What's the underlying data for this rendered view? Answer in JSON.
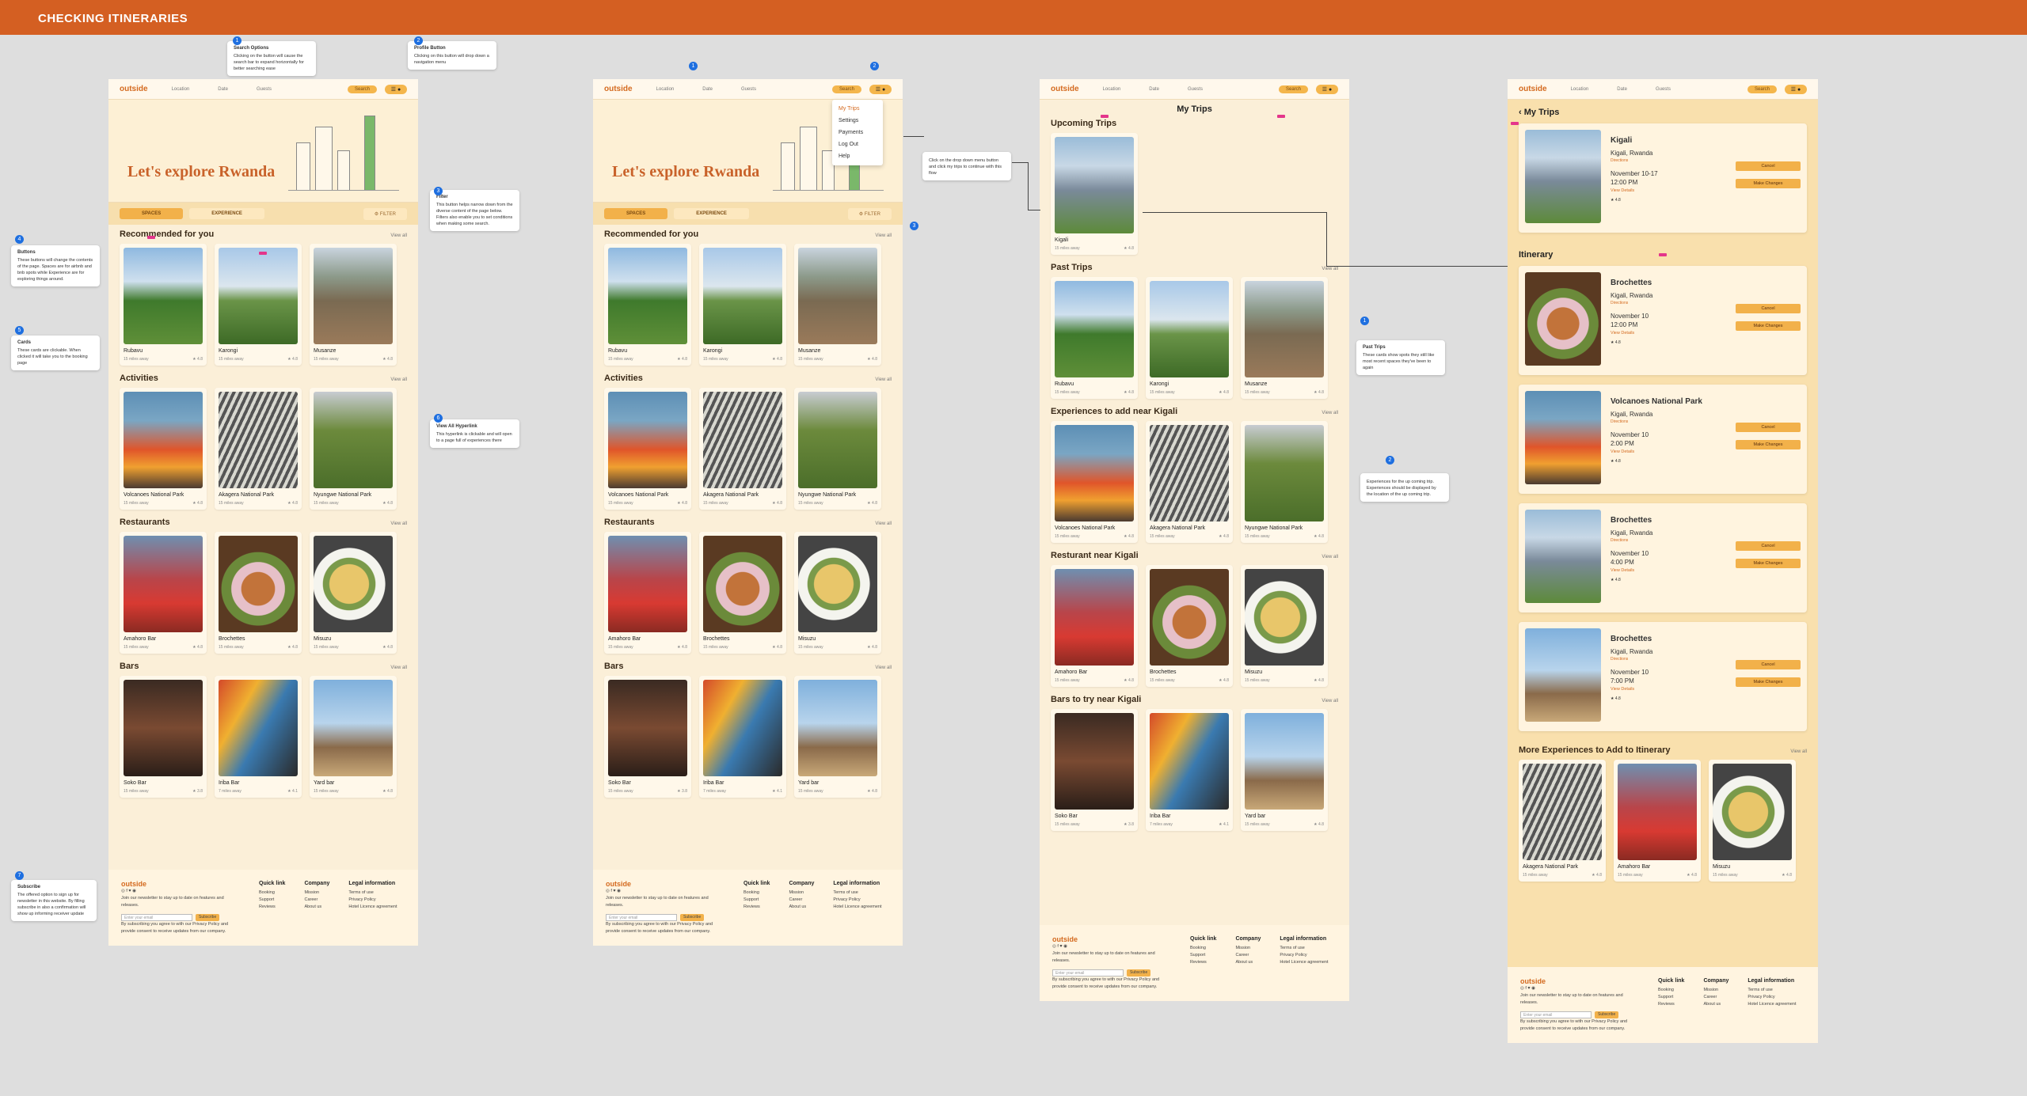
{
  "banner": {
    "title": "CHECKING ITINERARIES"
  },
  "nav": {
    "logo": "outside",
    "items": [
      "Location",
      "Date",
      "Guests"
    ],
    "search": "Search",
    "avatar": "☰ ●"
  },
  "hero": {
    "title": "Let's explore Rwanda"
  },
  "tabs": {
    "spaces": "SPACES",
    "experience": "EXPERIENCE",
    "filter": "⚙ FILTER"
  },
  "view_all": "View all",
  "sections": {
    "recommended": {
      "title": "Recommended for you",
      "cards": [
        {
          "name": "Rubavu",
          "dist": "15 miles away",
          "rating": "★ 4.8"
        },
        {
          "name": "Karongi",
          "dist": "15 miles away",
          "rating": "★ 4.8"
        },
        {
          "name": "Musanze",
          "dist": "15 miles away",
          "rating": "★ 4.8"
        }
      ]
    },
    "activities": {
      "title": "Activities",
      "cards": [
        {
          "name": "Volcanoes National Park",
          "dist": "15 miles away",
          "rating": "★ 4.8"
        },
        {
          "name": "Akagera National Park",
          "dist": "15 miles away",
          "rating": "★ 4.8"
        },
        {
          "name": "Nyungwe National Park",
          "dist": "15 miles away",
          "rating": "★ 4.8"
        }
      ]
    },
    "restaurants": {
      "title": "Restaurants",
      "cards": [
        {
          "name": "Amahoro Bar",
          "dist": "15 miles away",
          "rating": "★ 4.8"
        },
        {
          "name": "Brochettes",
          "dist": "15 miles away",
          "rating": "★ 4.8"
        },
        {
          "name": "Misuzu",
          "dist": "15 miles away",
          "rating": "★ 4.8"
        }
      ]
    },
    "bars": {
      "title": "Bars",
      "cards": [
        {
          "name": "Soko Bar",
          "dist": "15 miles away",
          "rating": "★ 3.8"
        },
        {
          "name": "Iriba Bar",
          "dist": "7 miles away",
          "rating": "★ 4.1"
        },
        {
          "name": "Yard bar",
          "dist": "15 miles away",
          "rating": "★ 4.8"
        }
      ]
    }
  },
  "footer": {
    "logo": "outside",
    "social": "◎ f ♥ ◉",
    "newsletter": "Join our newsletter to stay up to date on features and releases.",
    "email_placeholder": "Enter your email",
    "subscribe": "Subscribe",
    "consent": "By subscribing you agree to with our Privacy Policy and provide consent to receive updates from our company.",
    "cols": [
      {
        "title": "Quick link",
        "items": [
          "Booking",
          "Support",
          "Reviews"
        ]
      },
      {
        "title": "Company",
        "items": [
          "Mission",
          "Career",
          "About us"
        ]
      },
      {
        "title": "Legal information",
        "items": [
          "Terms of use",
          "Privacy Policy",
          "Hotel Licence agreement"
        ]
      }
    ]
  },
  "menu": {
    "items": [
      "My Trips",
      "Settings",
      "Payments",
      "Log Out",
      "Help"
    ]
  },
  "trips": {
    "title": "My Trips",
    "upcoming": "Upcoming Trips",
    "upcoming_card": {
      "name": "Kigali",
      "dist": "15 miles away",
      "rating": "★ 4.8"
    },
    "past": "Past Trips",
    "experiences": "Experiences to add near Kigali",
    "restaurants": "Resturant near Kigali",
    "bars": "Bars to try near Kigali"
  },
  "itinerary": {
    "back_title": "My Trips",
    "heading": "Itinerary",
    "top": {
      "name": "Kigali",
      "loc": "Kigali, Rwanda",
      "dir": "Directions",
      "date": "November 10-17",
      "time": "12:00 PM",
      "details": "View Details",
      "rating": "★ 4.8"
    },
    "items": [
      {
        "name": "Brochettes",
        "loc": "Kigali, Rwanda",
        "dir": "Directions",
        "date": "November 10",
        "time": "12:00 PM",
        "details": "View Details",
        "rating": "★ 4.8"
      },
      {
        "name": "Volcanoes National Park",
        "loc": "Kigali, Rwanda",
        "dir": "Directions",
        "date": "November 10",
        "time": "2:00 PM",
        "details": "View Details",
        "rating": "★ 4.8"
      },
      {
        "name": "Brochettes",
        "loc": "Kigali, Rwanda",
        "dir": "Directions",
        "date": "November 10",
        "time": "4:00 PM",
        "details": "View Details",
        "rating": "★ 4.8"
      },
      {
        "name": "Brochettes",
        "loc": "Kigali, Rwanda",
        "dir": "Directions",
        "date": "November 10",
        "time": "7:00 PM",
        "details": "View Details",
        "rating": "★ 4.8"
      }
    ],
    "cancel": "Cancel",
    "change": "Make Changes",
    "more": "More Experiences to  Add to Itinerary"
  },
  "notes": [
    {
      "title": "Search Options",
      "text": "Clicking on the button will cause the search bar to expand horizontally for better searching ease"
    },
    {
      "title": "Profile Button",
      "text": "Clicking on this button will drop down a navigation menu"
    },
    {
      "title": "Filter",
      "text": "This button helps narrow down from the diverse content of the page below. Filters also enable you to set conditions when making some search."
    },
    {
      "title": "Buttons",
      "text": "These buttons will change the contents of the page. Spaces are for airbnb and bnb spots while Experience are for exploring things around."
    },
    {
      "title": "Cards",
      "text": "These cards are clickable. When clicked it will take you to the booking page"
    },
    {
      "title": "View All Hyperlink",
      "text": "This hyperlink is clickable and will open to a page full of experiences there"
    },
    {
      "title": "Subscribe",
      "text": "The offered option to sign up for newsletter in this website. By filling subscribe in also a confirmation will show up informing receiver update"
    },
    {
      "title": "",
      "text": "Click on the drop down menu button and click my trips to continue with this flow"
    },
    {
      "title": "Past Trips",
      "text": "These cards show spots they still like most recent spaces they've been to again"
    },
    {
      "title": "",
      "text": "Experiences for the up coming trip. Experiences should be displayed by the location of the up coming trip."
    }
  ],
  "colors": {
    "banner": "#d45f22",
    "accent": "#f2b14a",
    "page": "#fbefd8",
    "annotation": "#1e6fe0",
    "pin": "#e4358b"
  }
}
